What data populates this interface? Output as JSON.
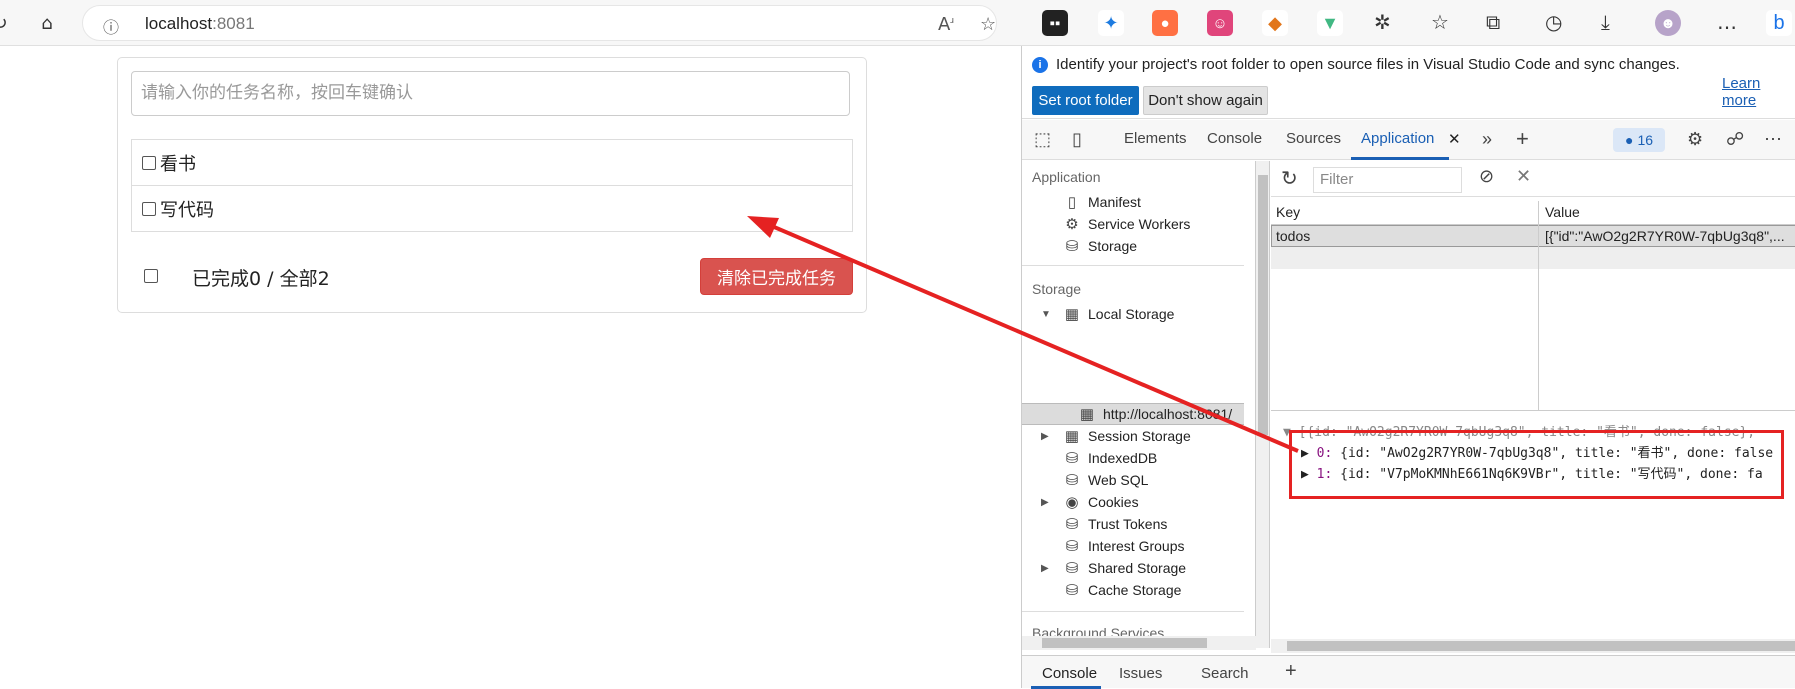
{
  "browser": {
    "url_host": "localhost",
    "url_port": ":8081",
    "info_icon": "info-icon"
  },
  "app": {
    "input_placeholder": "请输入你的任务名称，按回车键确认",
    "todos": [
      {
        "title": "看书",
        "done": false
      },
      {
        "title": "写代码",
        "done": false
      }
    ],
    "summary": "已完成0 / 全部2",
    "clear_label": "清除已完成任务"
  },
  "devtools": {
    "banner_text": "Identify your project's root folder to open source files in Visual Studio Code and sync changes.",
    "learn_more": "Learn more",
    "set_root": "Set root folder",
    "dont_show": "Don't show again",
    "tabs": [
      "Elements",
      "Console",
      "Sources",
      "Application"
    ],
    "active_tab": "Application",
    "badge_count": "16",
    "sidebar": {
      "application_head": "Application",
      "application_items": [
        "Manifest",
        "Service Workers",
        "Storage"
      ],
      "storage_head": "Storage",
      "local_storage": "Local Storage",
      "local_storage_origin": "http://localhost:8081/",
      "storage_items": [
        "Session Storage",
        "IndexedDB",
        "Web SQL",
        "Cookies",
        "Trust Tokens",
        "Interest Groups",
        "Shared Storage",
        "Cache Storage"
      ],
      "background_head": "Background Services"
    },
    "filter_placeholder": "Filter",
    "table": {
      "key_header": "Key",
      "value_header": "Value",
      "rows": [
        {
          "key": "todos",
          "value": "[{\"id\":\"AwO2g2R7YR0W-7qbUg3q8\",..."
        }
      ]
    },
    "preview": {
      "summary": "[{id: \"AwO2g2R7YR0W-7qbUg3q8\", title: \"看书\", done: false},",
      "items": [
        {
          "index": "0:",
          "text": "{id: \"AwO2g2R7YR0W-7qbUg3q8\", title: \"看书\", done: false"
        },
        {
          "index": "1:",
          "text": "{id: \"V7pMoKMNhE661Nq6K9VBr\", title: \"写代码\", done: fa"
        }
      ]
    },
    "drawer_tabs": [
      "Console",
      "Issues",
      "Search"
    ]
  },
  "colors": {
    "accent": "#1a5fb4",
    "danger": "#d9534f",
    "annotation": "#e52222"
  }
}
